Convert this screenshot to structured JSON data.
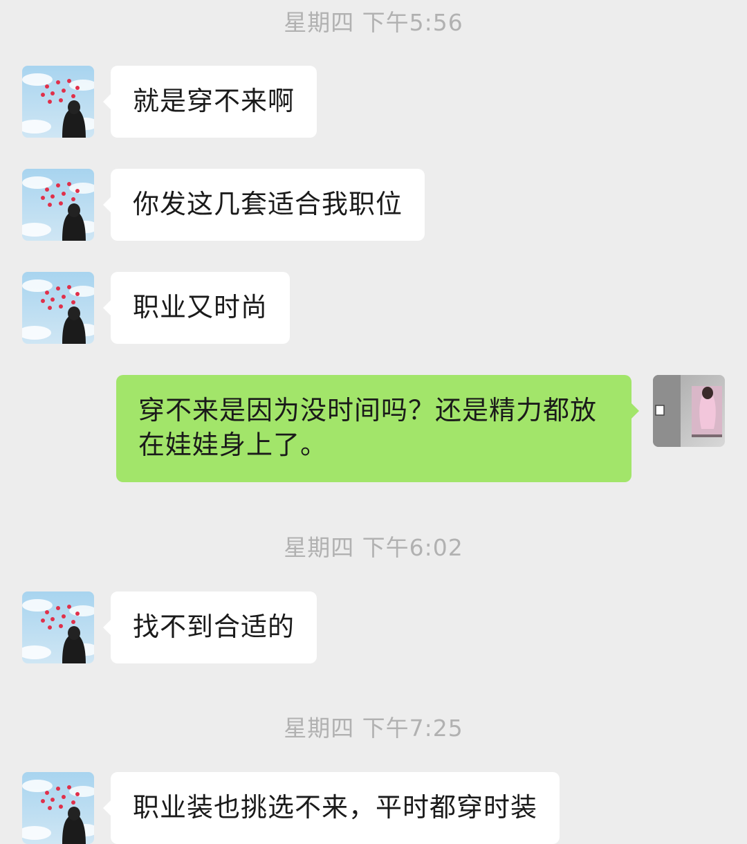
{
  "colors": {
    "background": "#ededed",
    "incoming_bubble": "#ffffff",
    "outgoing_bubble": "#a2e56a",
    "timestamp_text": "#b1b1b1"
  },
  "timestamps": [
    "星期四 下午5:56",
    "星期四 下午6:02",
    "星期四 下午7:25"
  ],
  "messages": [
    {
      "sender": "contact",
      "text": "就是穿不来啊"
    },
    {
      "sender": "contact",
      "text": "你发这几套适合我职位"
    },
    {
      "sender": "contact",
      "text": "职业又时尚"
    },
    {
      "sender": "self",
      "text": "穿不来是因为没时间吗？还是精力都放在娃娃身上了。"
    },
    {
      "sender": "contact",
      "text": "找不到合适的"
    },
    {
      "sender": "contact",
      "text": "职业装也挑选不来，平时都穿时装"
    }
  ]
}
